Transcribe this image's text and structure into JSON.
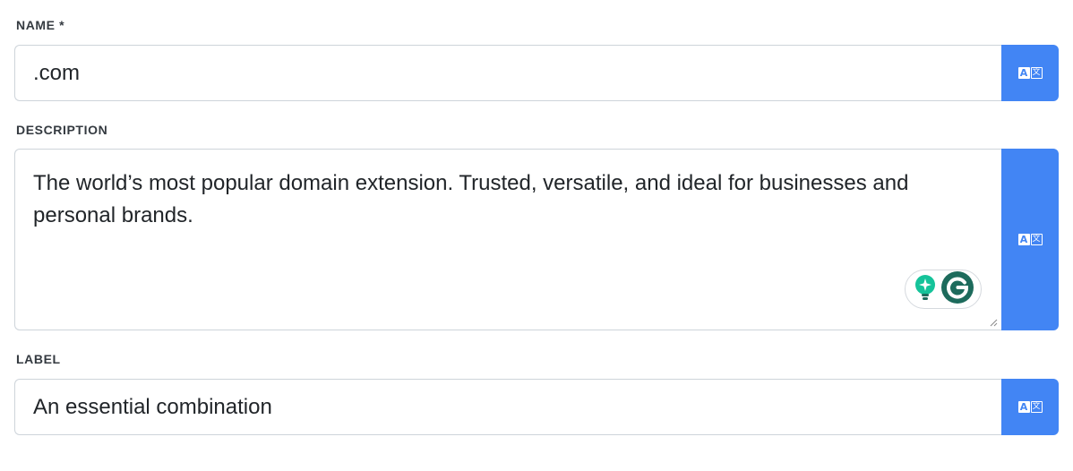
{
  "fields": {
    "name": {
      "label": "NAME *",
      "value": ".com",
      "translate_icon": "translate-icon"
    },
    "description": {
      "label": "DESCRIPTION",
      "value": "The world’s most popular domain extension. Trusted, versatile, and ideal for businesses and personal brands.",
      "translate_icon": "translate-icon"
    },
    "label": {
      "label": "LABEL",
      "value": "An essential combination",
      "translate_icon": "translate-icon"
    }
  },
  "translate_glyphs": {
    "latin": "A",
    "cjk": "文"
  },
  "grammarly": {
    "suggest_icon": "lightbulb-icon",
    "logo_icon": "grammarly-icon"
  },
  "colors": {
    "accent": "#4285f4",
    "border": "#ced4da",
    "grammarly_green": "#15c39a",
    "grammarly_dark": "#1d6b5c"
  }
}
